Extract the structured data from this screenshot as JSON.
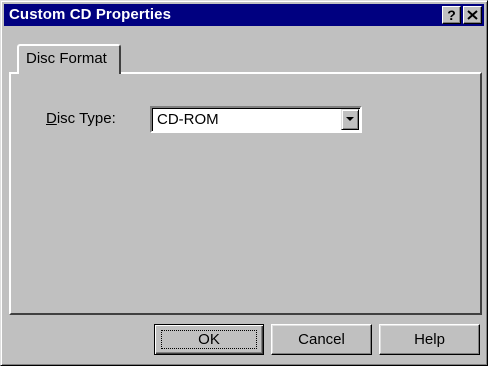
{
  "window": {
    "title": "Custom CD Properties",
    "help_button": "?",
    "close_button": "✕"
  },
  "tabs": [
    {
      "label": "Disc Format",
      "active": true
    }
  ],
  "disc_type": {
    "label_mnemonic": "D",
    "label_rest": "isc Type:",
    "value": "CD-ROM"
  },
  "buttons": {
    "ok": "OK",
    "cancel": "Cancel",
    "help": "Help"
  },
  "colors": {
    "titlebar": "#000080",
    "face": "#c0c0c0"
  }
}
